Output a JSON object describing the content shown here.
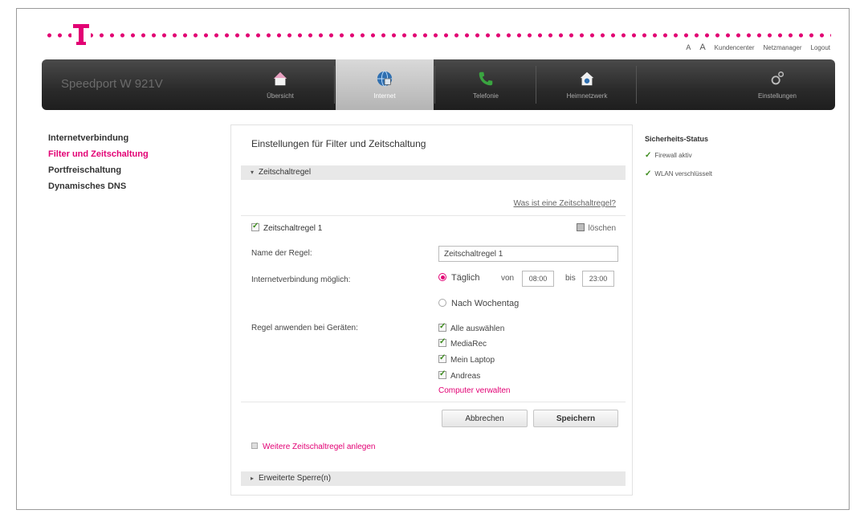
{
  "brand": {
    "color": "#e20074",
    "logo_icon": "telekom-t-icon"
  },
  "toplinks": [
    "A",
    "A",
    "Kundencenter",
    "Netzmanager",
    "Logout"
  ],
  "navbar": {
    "product": "Speedport W 921V",
    "items": [
      {
        "label": "Übersicht",
        "icon": "house-icon"
      },
      {
        "label": "Internet",
        "icon": "globe-icon"
      },
      {
        "label": "Telefonie",
        "icon": "phone-icon"
      },
      {
        "label": "Heimnetzwerk",
        "icon": "home-network-icon"
      },
      {
        "label": "Einstellungen",
        "icon": "gear-icon"
      }
    ],
    "active_index": 1
  },
  "sidenav": [
    "Internetverbindung",
    "Filter und Zeitschaltung",
    "Portfreischaltung",
    "Dynamisches DNS"
  ],
  "panel": {
    "title": "Einstellungen für Filter und Zeitschaltung",
    "section_timer": "Zeitschaltregel",
    "help_link": "Was ist eine Zeitschaltregel?",
    "rule_header": "Zeitschaltregel 1",
    "delete_label": "löschen",
    "name_label": "Name der Regel:",
    "name_value": "Zeitschaltregel 1",
    "conn_label": "Internetverbindung möglich:",
    "daily_label": "Täglich",
    "from_label": "von",
    "from_value": "08:00",
    "to_label": "bis",
    "to_value": "23:00",
    "weekday_label": "Nach Wochentag",
    "devices_label": "Regel anwenden bei Geräten:",
    "devices": [
      "Alle auswählen",
      "MediaRec",
      "Mein Laptop",
      "Andreas"
    ],
    "manage_link": "Computer verwalten",
    "cancel_button": "Abbrechen",
    "save_button": "Speichern",
    "add_rule": "Weitere Zeitschaltregel anlegen",
    "section_blocks": "Erweiterte Sperre(n)"
  },
  "status": {
    "title": "Sicherheits-Status",
    "items": [
      "Firewall aktiv",
      "WLAN verschlüsselt"
    ]
  }
}
